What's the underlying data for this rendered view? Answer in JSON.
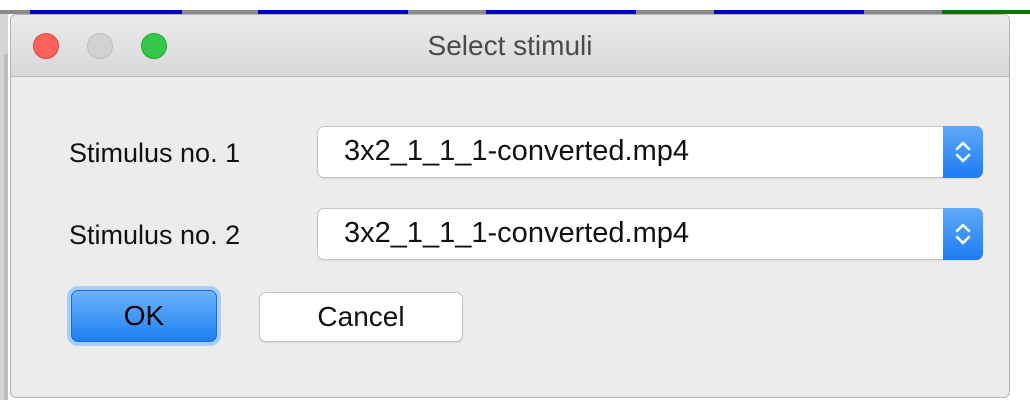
{
  "window": {
    "title": "Select stimuli"
  },
  "stimuli": [
    {
      "label": "Stimulus no. 1",
      "selected": "3x2_1_1_1-converted.mp4"
    },
    {
      "label": "Stimulus no. 2",
      "selected": "3x2_1_1_1-converted.mp4"
    }
  ],
  "buttons": {
    "ok_label": "OK",
    "cancel_label": "Cancel"
  },
  "colors": {
    "accent": "#1e80f2",
    "close": "#fc605c",
    "maximize": "#34c84a",
    "background_strip_blue": "#0000cc",
    "background_strip_green": "#007a00",
    "background_strip_gray": "#8a8a8a"
  },
  "icons": {
    "popup_indicator": "up-down-chevron-icon"
  }
}
